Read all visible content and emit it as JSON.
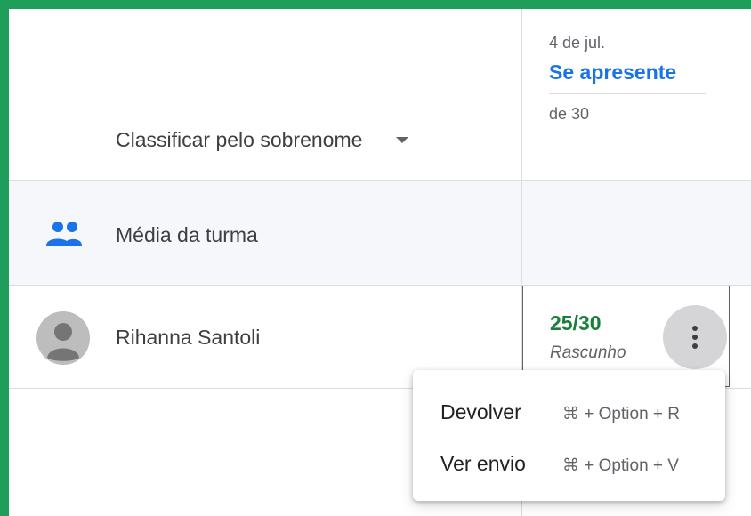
{
  "header": {
    "sort_label": "Classificar pelo sobrenome"
  },
  "assignment": {
    "date": "4 de jul.",
    "title": "Se apresente",
    "points": "de 30"
  },
  "class_average": {
    "label": "Média da turma"
  },
  "student": {
    "name": "Rihanna Santoli",
    "grade": "25/30",
    "status": "Rascunho"
  },
  "context_menu": {
    "items": [
      {
        "label": "Devolver",
        "shortcut": "⌘ + Option + R"
      },
      {
        "label": "Ver envio",
        "shortcut": "⌘ + Option + V"
      }
    ]
  },
  "colors": {
    "frame": "#1e9e5a",
    "accent_blue": "#1a73e8",
    "grade_green": "#188038"
  }
}
